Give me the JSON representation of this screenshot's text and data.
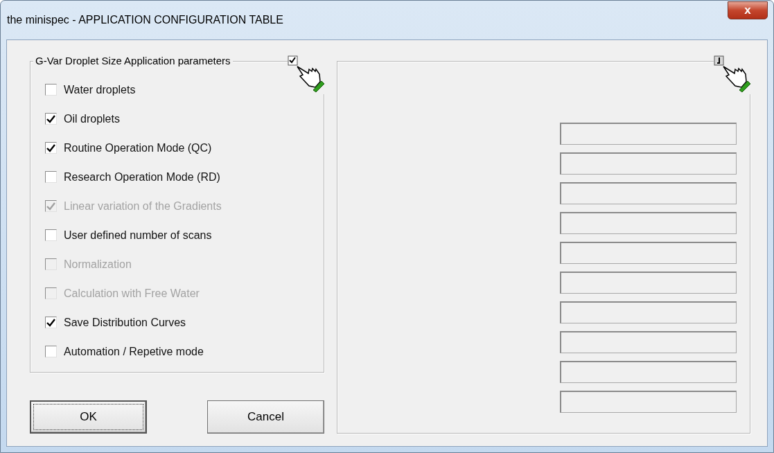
{
  "window": {
    "title": "the minispec - APPLICATION CONFIGURATION TABLE",
    "close_label": "x"
  },
  "parameters_group": {
    "title": "G-Var Droplet Size Application parameters",
    "toggle_checked": true,
    "options": [
      {
        "label": "Water droplets",
        "checked": false,
        "disabled": false
      },
      {
        "label": "Oil droplets",
        "checked": true,
        "disabled": false
      },
      {
        "label": "Routine Operation Mode (QC)",
        "checked": true,
        "disabled": false
      },
      {
        "label": "Research Operation Mode (RD)",
        "checked": false,
        "disabled": false
      },
      {
        "label": "Linear variation of the Gradients",
        "checked": true,
        "disabled": true
      },
      {
        "label": "User defined number of scans",
        "checked": false,
        "disabled": false
      },
      {
        "label": "Normalization",
        "checked": false,
        "disabled": true
      },
      {
        "label": "Calculation with Free Water",
        "checked": false,
        "disabled": true
      },
      {
        "label": "Save Distribution Curves",
        "checked": true,
        "disabled": false
      },
      {
        "label": "Automation / Repetive mode",
        "checked": false,
        "disabled": false
      }
    ]
  },
  "buttons": [
    {
      "label": "OK",
      "default": true
    },
    {
      "label": "Cancel",
      "default": false
    }
  ],
  "side_group": {
    "toggle_checked": false,
    "fields": [
      {
        "disabled": true
      },
      {
        "disabled": true
      },
      {
        "disabled": true
      },
      {
        "disabled": true
      },
      {
        "disabled": true
      },
      {
        "disabled": true
      },
      {
        "disabled": true
      },
      {
        "disabled": true
      },
      {
        "disabled": true
      },
      {
        "disabled": true
      }
    ]
  }
}
